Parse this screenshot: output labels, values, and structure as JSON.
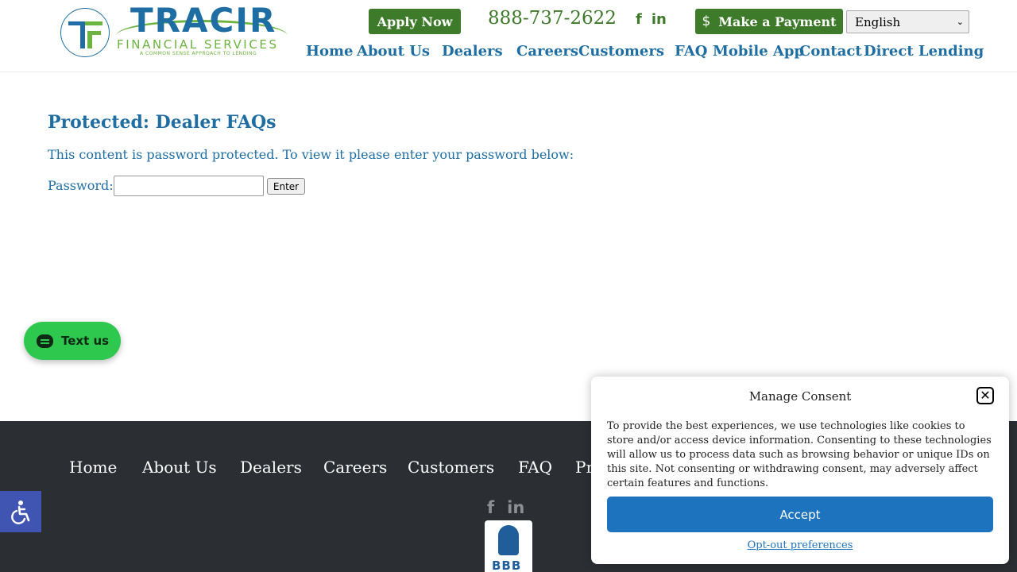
{
  "header": {
    "logo": {
      "name": "TRACIR",
      "sub": "FINANCIAL SERVICES",
      "tagline": "A COMMON SENSE APPROACH TO LENDING"
    },
    "apply_label": "Apply Now",
    "phone": "888-737-2622",
    "payment_label": "Make a Payment",
    "payment_icon": "$",
    "social": [
      "facebook-icon",
      "linkedin-icon"
    ],
    "language": "English",
    "nav": [
      "Home",
      "About Us",
      "Dealers",
      "Careers",
      "Customers",
      "FAQ",
      "Mobile App",
      "Contact",
      "Direct Lending"
    ]
  },
  "main": {
    "title": "Protected: Dealer FAQs",
    "notice": "This content is password protected. To view it please enter your password below:",
    "password_label": "Password:",
    "password_value": "",
    "enter_label": "Enter"
  },
  "chat": {
    "label": "Text us"
  },
  "footer": {
    "nav": [
      "Home",
      "About Us",
      "Dealers",
      "Careers",
      "Customers",
      "FAQ",
      "Pr"
    ],
    "bbb": "BBB"
  },
  "consent": {
    "title": "Manage Consent",
    "text": "To provide the best experiences, we use technologies like cookies to store and/or access device information. Consenting to these technologies will allow us to process data such as browsing behavior or unique IDs on this site. Not consenting or withdrawing consent, may adversely affect certain features and functions.",
    "accept_label": "Accept",
    "optout_label": "Opt-out preferences"
  },
  "colors": {
    "brand_blue": "#1f6ea3",
    "brand_green": "#3d7a2a",
    "chat_green": "#2dc84d",
    "footer_bg": "#2b2e33",
    "accept_blue": "#1e73be",
    "accessibility": "#4054b2"
  }
}
